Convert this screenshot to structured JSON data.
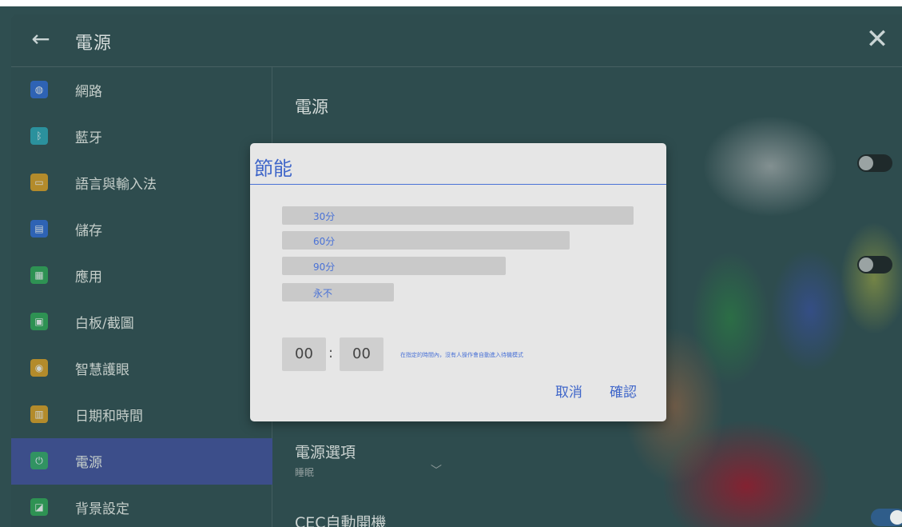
{
  "window": {
    "title": "電源"
  },
  "sidebar": {
    "items": [
      {
        "label": "網路",
        "icon": "globe-icon",
        "color": "#2f6bd6"
      },
      {
        "label": "藍牙",
        "icon": "bluetooth-icon",
        "color": "#2aa8b8"
      },
      {
        "label": "語言與輸入法",
        "icon": "keyboard-icon",
        "color": "#e0a020"
      },
      {
        "label": "儲存",
        "icon": "storage-icon",
        "color": "#2f6bd6"
      },
      {
        "label": "應用",
        "icon": "apps-icon",
        "color": "#2eaa55"
      },
      {
        "label": "白板/截圖",
        "icon": "whiteboard-icon",
        "color": "#2eaa55"
      },
      {
        "label": "智慧護眼",
        "icon": "eye-icon",
        "color": "#e0a020"
      },
      {
        "label": "日期和時間",
        "icon": "calendar-icon",
        "color": "#e0a020"
      },
      {
        "label": "電源",
        "icon": "power-icon",
        "color": "#2eaa55",
        "active": true
      },
      {
        "label": "背景設定",
        "icon": "image-icon",
        "color": "#2eaa55"
      }
    ]
  },
  "content": {
    "title": "電源",
    "power_options": {
      "title": "電源選項",
      "value": "睡眠"
    },
    "cec": {
      "title": "CEC自動開機"
    }
  },
  "dialog": {
    "title": "節能",
    "options": [
      "30分",
      "60分",
      "90分",
      "永不"
    ],
    "time": {
      "hours": "00",
      "separator": ":",
      "minutes": "00"
    },
    "hint": "在指定的時間內，沒有人操作會自動進入待機模式",
    "cancel": "取消",
    "confirm": "確認"
  },
  "colors": {
    "accent": "#4a72d6",
    "active_bg": "#3c4e8a",
    "dialog_bg": "#e6e6e6"
  }
}
